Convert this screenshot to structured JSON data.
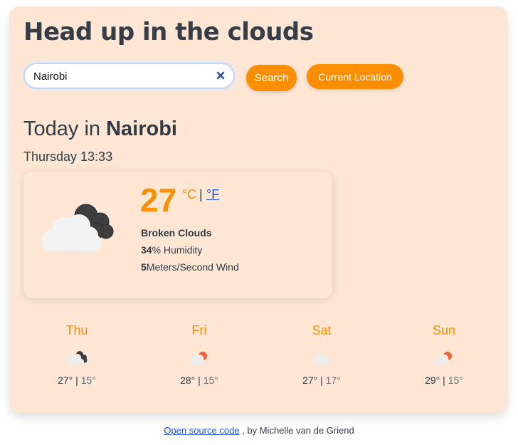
{
  "app": {
    "title": "Head up in the clouds"
  },
  "search": {
    "value": "Nairobi",
    "button_label": "Search",
    "location_button_label": "Current Location"
  },
  "today": {
    "prefix": "Today in ",
    "city": "Nairobi",
    "datetime": "Thursday 13:33"
  },
  "current": {
    "temperature": "27",
    "unit_c": "°C",
    "unit_sep": "|",
    "unit_f": "°F",
    "description": "Broken Clouds",
    "humidity_value": "34",
    "humidity_label": "% Humidity",
    "wind_value": "5",
    "wind_label": "Meters/Second Wind",
    "icon": "broken-clouds-icon"
  },
  "forecast": [
    {
      "day": "Thu",
      "max": "27°",
      "sep": " | ",
      "min": "15°",
      "icon": "broken-clouds-icon"
    },
    {
      "day": "Fri",
      "max": "28°",
      "sep": " | ",
      "min": "15°",
      "icon": "sun-behind-cloud-icon"
    },
    {
      "day": "Sat",
      "max": "27°",
      "sep": " | ",
      "min": "17°",
      "icon": "cloud-icon"
    },
    {
      "day": "Sun",
      "max": "29°",
      "sep": " | ",
      "min": "15°",
      "icon": "sun-behind-cloud-icon"
    }
  ],
  "footer": {
    "link_text": "Open source code",
    "suffix": " , by Michelle van de Griend"
  },
  "colors": {
    "accent": "#fd8e00",
    "card_bg": "#fde6d4",
    "link": "#1a4fd6",
    "text": "#333a44"
  }
}
